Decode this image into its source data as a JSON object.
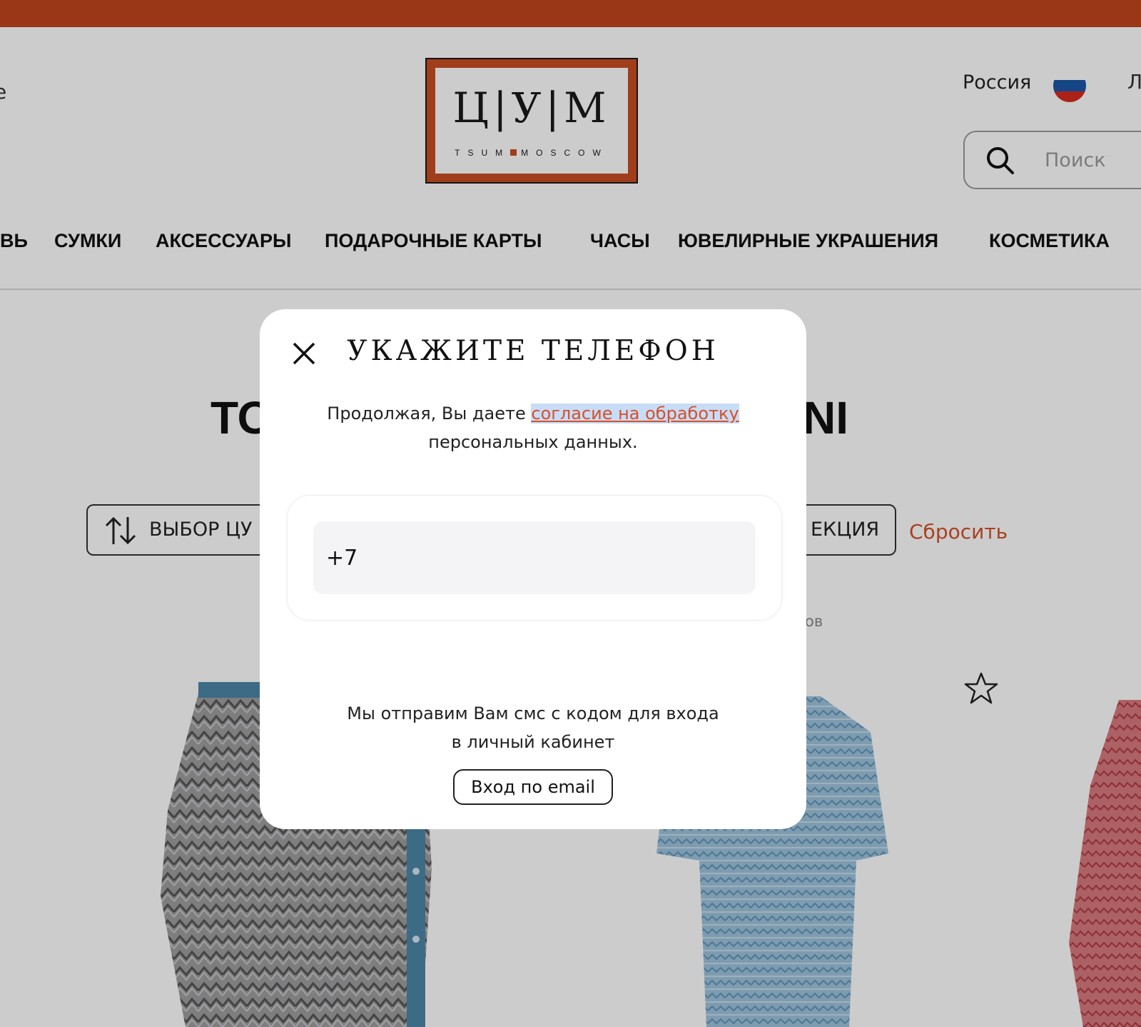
{
  "colors": {
    "brand_orange": "#c0451c",
    "link_red": "#d5512a",
    "overlay": "rgba(0,0,0,0.2)"
  },
  "header": {
    "left_edge_text": "е",
    "right_edge_text": "Л",
    "logo": {
      "main": "Ц|У|М",
      "sub_left": "TSUM",
      "sub_right": "MOSCOW"
    },
    "country": "Россия",
    "search_placeholder": "Поиск"
  },
  "nav": {
    "items": [
      {
        "label": "ВЬ"
      },
      {
        "label": "СУМКИ"
      },
      {
        "label": "АКСЕССУАРЫ"
      },
      {
        "label": "ПОДАРОЧНЫЕ КАРТЫ"
      },
      {
        "label": "ЧАСЫ"
      },
      {
        "label": "ЮВЕЛИРНЫЕ УКРАШЕНИЯ"
      },
      {
        "label": "КОСМЕТИКА"
      }
    ]
  },
  "catalog": {
    "title_left": "ТО",
    "title_right": "NI",
    "sort_label": "ВЫБОР ЦУ",
    "collection_label": "ЕКЦИЯ",
    "reset_label": "Сбросить",
    "count_fragment": "ов"
  },
  "modal": {
    "title": "УКАЖИТЕ ТЕЛЕФОН",
    "consent_prefix": "Продолжая, Вы даете ",
    "consent_link": "согласие на обработку",
    "consent_suffix": "персональных данных.",
    "phone_value": "+7",
    "sms_line1": "Мы отправим Вам смс с кодом для входа",
    "sms_line2": "в личный кабинет",
    "email_button": "Вход по email"
  }
}
